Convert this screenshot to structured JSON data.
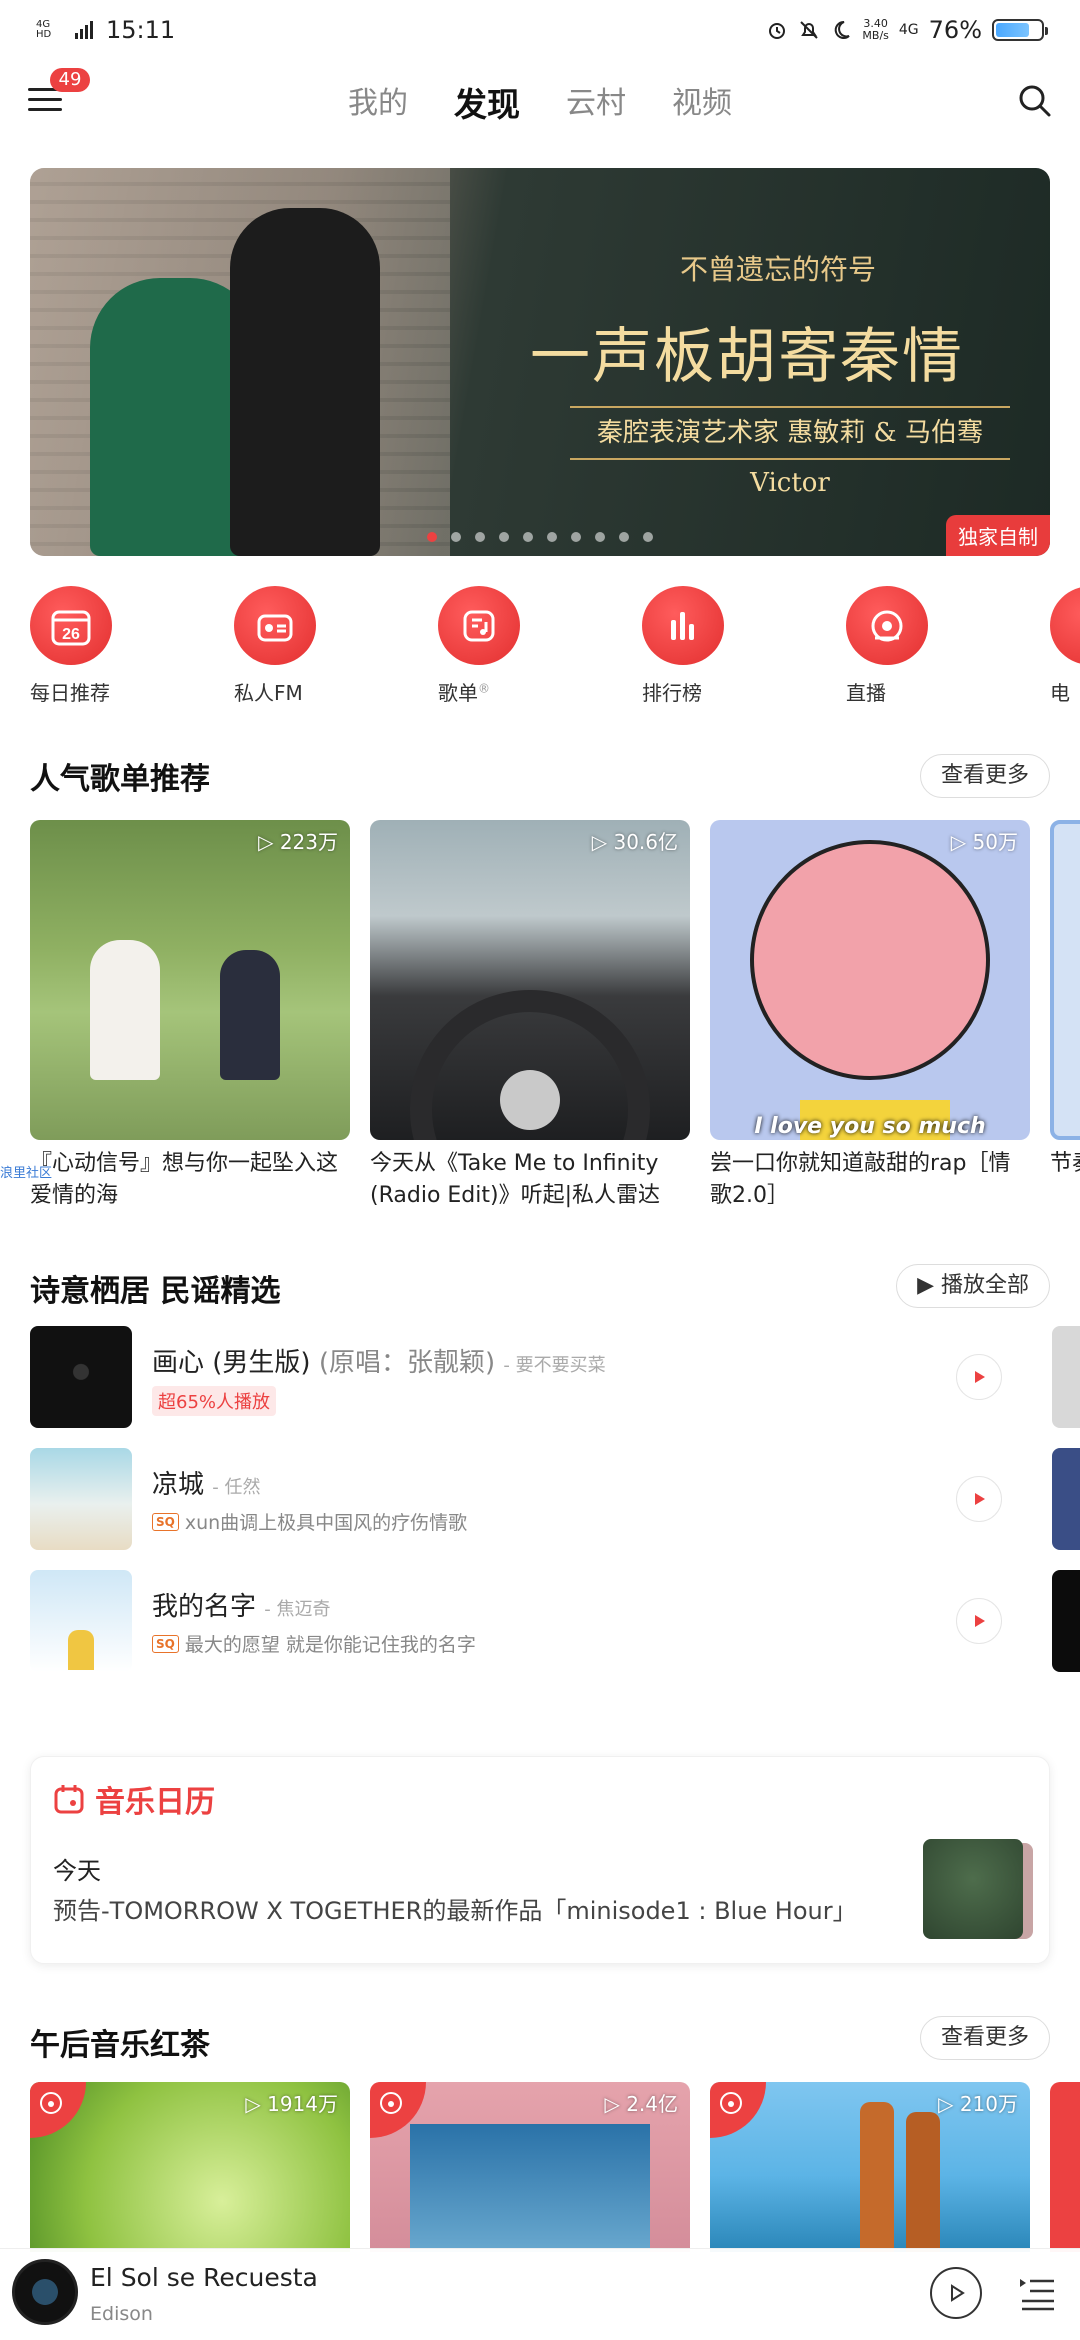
{
  "status_bar": {
    "network": "4G HD",
    "time": "15:11",
    "speed_value": "3.40",
    "speed_unit": "MB/s",
    "cell": "4G",
    "battery": "76%",
    "battery_level": 0.76
  },
  "header": {
    "menu_badge": "49",
    "tabs": [
      {
        "label": "我的",
        "active": false
      },
      {
        "label": "发现",
        "active": true
      },
      {
        "label": "云村",
        "active": false
      },
      {
        "label": "视频",
        "active": false
      }
    ]
  },
  "banner": {
    "subtitle": "不曾遗忘的符号",
    "title": "一声板胡寄秦情",
    "artist_line": "秦腔表演艺术家 惠敏莉 & 马伯骞Victor",
    "tag": "独家自制",
    "page_count": 10,
    "active_page": 1
  },
  "quick_entries": [
    {
      "label": "每日推荐",
      "icon": "calendar-icon",
      "day": "26"
    },
    {
      "label": "私人FM",
      "icon": "radio-icon"
    },
    {
      "label": "歌单",
      "icon": "playlist-icon",
      "mark": "®"
    },
    {
      "label": "排行榜",
      "icon": "chart-bars-icon"
    },
    {
      "label": "直播",
      "icon": "live-icon"
    },
    {
      "label": "电",
      "icon": "partial-icon"
    }
  ],
  "popular_playlists": {
    "title": "人气歌单推荐",
    "more": "查看更多",
    "items": [
      {
        "count": "223万",
        "title": "『心动信号』想与你一起坠入这爱情的海"
      },
      {
        "count": "30.6亿",
        "title": "今天从《Take Me to Infinity (Radio Edit)》听起|私人雷达"
      },
      {
        "count": "50万",
        "title": "尝一口你就知道敲甜的rap［情歌2.0］",
        "caption": "I love you so much"
      },
      {
        "count": "",
        "title": "节奏"
      }
    ],
    "watermark": "浪里社区"
  },
  "folk_section": {
    "title": "诗意栖居 民谣精选",
    "play_all": "播放全部",
    "songs": [
      {
        "title": "画心 (男生版)",
        "original": "(原唱：张靓颖)",
        "artist": "- 要不要买菜",
        "tag": "超65%人播放",
        "desc": ""
      },
      {
        "title": "凉城",
        "original": "",
        "artist": "- 任然",
        "tag": "",
        "desc": "xun曲调上极具中国风的疗伤情歌"
      },
      {
        "title": "我的名字",
        "original": "",
        "artist": "- 焦迈奇",
        "tag": "",
        "desc": "最大的愿望 就是你能记住我的名字"
      }
    ],
    "sq_label": "SQ"
  },
  "calendar": {
    "title": "音乐日历",
    "today": "今天",
    "text": "预告-TOMORROW X TOGETHER的最新作品「minisode1 : Blue Hour」"
  },
  "afternoon": {
    "title": "午后音乐红茶",
    "more": "查看更多",
    "items": [
      {
        "count": "1914万"
      },
      {
        "count": "2.4亿"
      },
      {
        "count": "210万"
      }
    ]
  },
  "player": {
    "title": "El Sol se Recuesta",
    "artist": "Edison"
  },
  "colors": {
    "accent": "#ec4141",
    "text": "#222222",
    "muted": "#888888"
  }
}
